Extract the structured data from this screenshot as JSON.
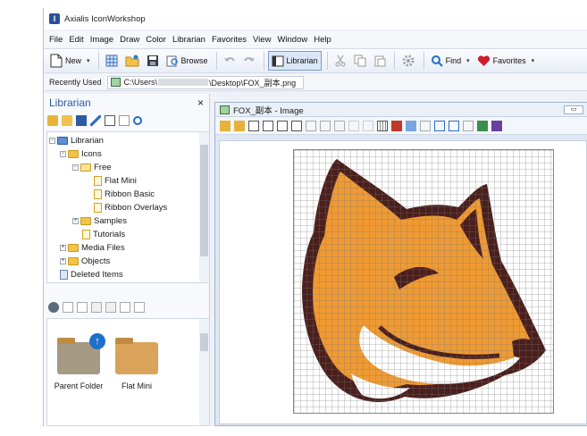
{
  "app": {
    "title": "Axialis IconWorkshop"
  },
  "menu": [
    "File",
    "Edit",
    "Image",
    "Draw",
    "Color",
    "Librarian",
    "Favorites",
    "View",
    "Window",
    "Help"
  ],
  "toolbar": {
    "new_label": "New",
    "browse_label": "Browse",
    "librarian_label": "Librarian",
    "find_label": "Find",
    "favorites_label": "Favorites"
  },
  "recent": {
    "label": "Recently Used",
    "path_prefix": "C:\\Users\\",
    "path_suffix": "\\Desktop\\FOX_副本.png"
  },
  "librarian": {
    "title": "Librarian",
    "close": "×",
    "tree": [
      "Librarian",
      "Icons",
      "Free",
      "Flat Mini",
      "Ribbon Basic",
      "Ribbon Overlays",
      "Samples",
      "Tutorials",
      "Media Files",
      "Objects",
      "Deleted Items"
    ],
    "thumbnails": [
      "Parent Folder",
      "Flat Mini"
    ]
  },
  "document": {
    "title": "FOX_副本 - Image"
  },
  "colors": {
    "fox_orange": "#ef9a33",
    "fox_outline": "#4a1f1c",
    "accent_blue": "#2b5ca8"
  }
}
